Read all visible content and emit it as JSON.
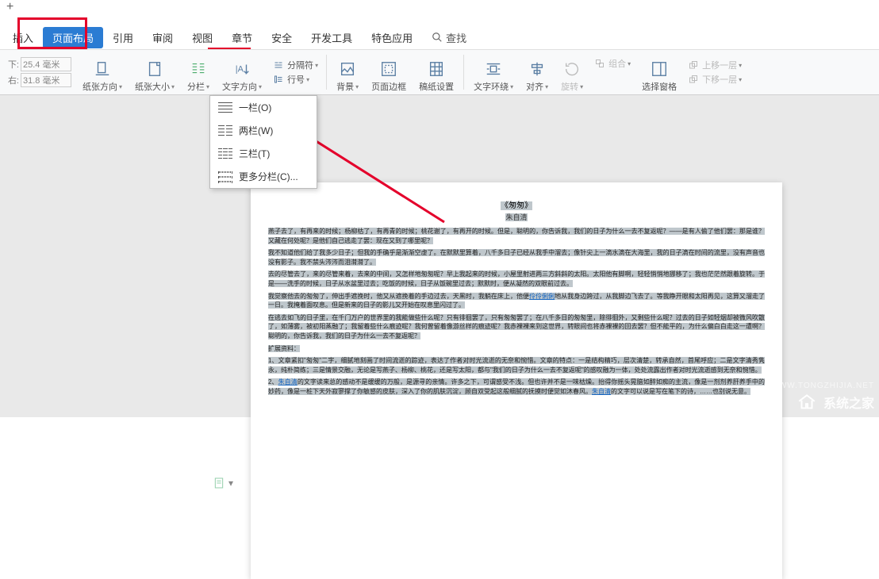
{
  "tabs": {
    "plus": "+"
  },
  "menu": {
    "items": [
      "插入",
      "页面布局",
      "引用",
      "审阅",
      "视图",
      "章节",
      "安全",
      "开发工具",
      "特色应用"
    ],
    "active_index": 1,
    "search_label": "查找"
  },
  "red_box_targets": [
    "page-layout-tab",
    "columns-button"
  ],
  "ribbon": {
    "margin": {
      "bottom_label": "下:",
      "bottom_value": "25.4 毫米",
      "right_label": "右:",
      "right_value": "31.8 毫米"
    },
    "orientation": "纸张方向",
    "size": "纸张大小",
    "columns": "分栏",
    "text_direction": "文字方向",
    "breaks": "分隔符",
    "line_numbers": "行号",
    "background": "背景",
    "page_border": "页面边框",
    "manuscript": "稿纸设置",
    "text_wrap": "文字环绕",
    "align": "对齐",
    "rotate": "旋转",
    "group": "组合",
    "selection_pane": "选择窗格",
    "bring_forward": "上移一层",
    "send_backward": "下移一层"
  },
  "dropdown": {
    "items": [
      {
        "label": "一栏(O)",
        "cols": 1
      },
      {
        "label": "两栏(W)",
        "cols": 2
      },
      {
        "label": "三栏(T)",
        "cols": 3
      },
      {
        "label": "更多分栏(C)...",
        "cols": 0
      }
    ]
  },
  "document": {
    "title": "《匆匆》",
    "author": "朱自清",
    "paragraphs": [
      "燕子去了，有再来的时候；杨柳枯了，有再青的时候；桃花谢了，有再开的时候。但是，聪明的，你告诉我，我们的日子为什么一去不复返呢？——是有人偷了他们罢：那是谁？又藏在何处呢？是他们自己逃走了罢：现在又到了哪里呢？",
      "我不知道他们给了我多少日子；但我的手确乎是渐渐空虚了。在默默里算着，八千多日子已经从我手中溜去；像针尖上一滴水滴在大海里，我的日子滴在时间的流里，没有声音也没有影子。我不禁头涔涔而泪潸潸了。",
      "去的尽管去了，来的尽管来着，去来的中间，又怎样地匆匆呢？早上我起来的时候，小屋里射进两三方斜斜的太阳。太阳他有脚啊，轻轻悄悄地挪移了；我也茫茫然跟着旋转。于是——洗手的时候，日子从水盆里过去；吃饭的时候，日子从饭碗里过去；默默时，便从凝然的双眼前过去。",
      "我觉察他去的匆匆了，伸出手遮挽时，他又从遮挽着的手边过去，天黑时，我躺在床上，他便伶伶俐俐地从我身边跨过，从我脚边飞去了。等我睁开眼和太阳再见，这算又溜走了一日。我掩着面叹息。但是新来的日子的影儿又开始在叹息里闪过了。",
      "在逃去如飞的日子里，在千门万户的世界里的我能做些什么呢？只有徘徊罢了，只有匆匆罢了；在八千多日的匆匆里，除徘徊外，又剩些什么呢？过去的日子如轻烟却被微风吹散了，如薄雾，被初阳蒸融了；我留着些什么痕迹呢？我何曾留着像游丝样的痕迹呢？我赤裸裸来到这世界，转眼间也将赤裸裸的回去罢？但不能平的，为什么偏白白走这一遭啊？聪明的，你告诉我，我们的日子为什么一去不复返呢？",
      "扩展资料：",
      "1、文章紧扣\"匆匆\"二字，细腻地刻画了时间流逝的踪迹，表达了作者对时光流逝的无奈和惋惜。文章的特点：一是结构精巧，层次清楚，转承自然，首尾呼应；二是文字清秀隽永，纯朴简练；三是情景交融，无论是写燕子、杨柳、桃花，还是写太阳，都与\"我们的日子为什么一去不复返呢\"的感叹融为一体，处处流露出作者对时光流逝感到无奈和惋惜。",
      "2、朱自清的文字读来总的感动不是缓缓的万般，是源寻的亲情。许多之下，可谓感受不浅。但也许并不是一味枯燥。抬得你摇头晃脑如醉如痴的主流，像是一剂剂养肝养手中的妙药，像是一桩下天外寂寥撑了你敏感的皮肤，深入了你的肌肤沉淀，顾自双受起这般细腻的抚摸时便觉如沐春风。朱自清的文字可以说是写在笔下的诗，……也别说无意。"
    ],
    "links": {
      "xuling_bingyu": "伶伶俐俐",
      "zhu_ziqing": "朱自清"
    }
  },
  "watermark": {
    "small": "WWW.TONGZHIJIA.NET",
    "large": "系统之家"
  }
}
